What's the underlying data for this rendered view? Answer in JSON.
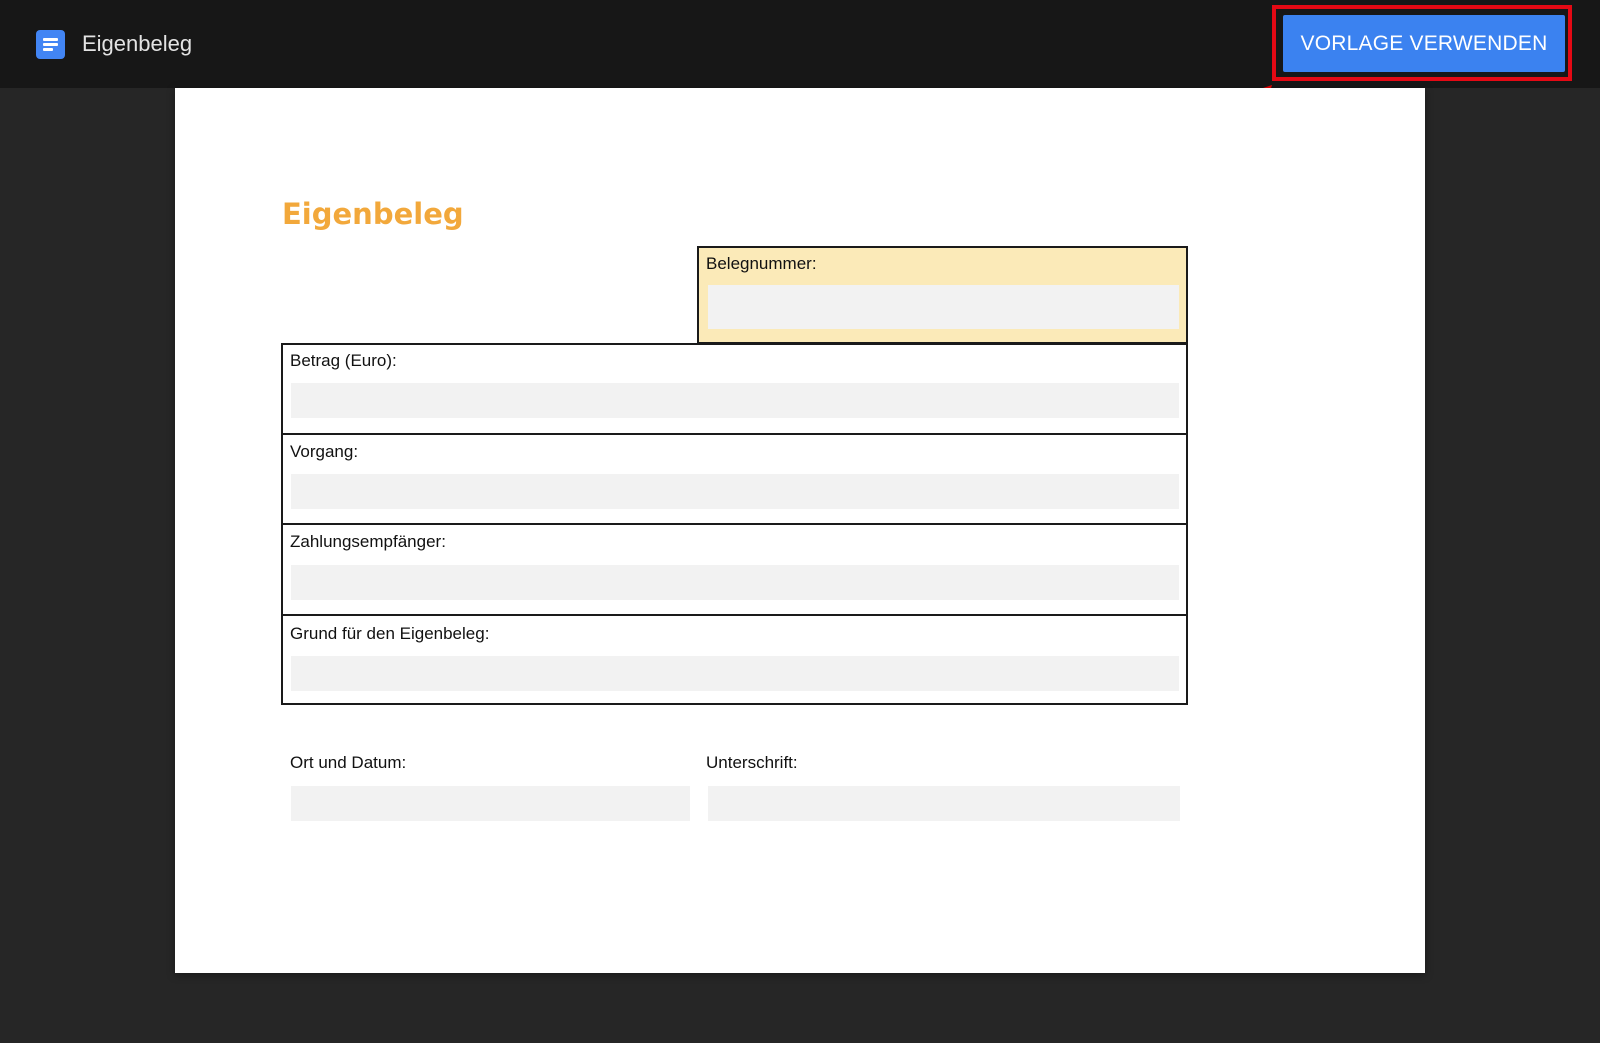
{
  "app": {
    "title": "Eigenbeleg",
    "icon": "docs-icon",
    "icon_color": "#4285f4"
  },
  "toolbar": {
    "use_template_label": "VORLAGE VERWENDEN",
    "button_color": "#3b82f0",
    "highlight_color": "#e50914"
  },
  "document": {
    "title": "Eigenbeleg",
    "title_color": "#f2a83b",
    "belegnummer": {
      "label": "Belegnummer:",
      "value": ""
    },
    "fields": [
      {
        "label": "Betrag (Euro):",
        "value": ""
      },
      {
        "label": "Vorgang:",
        "value": ""
      },
      {
        "label": "Zahlungsempfänger:",
        "value": ""
      },
      {
        "label": "Grund für den Eigenbeleg:",
        "value": ""
      }
    ],
    "ort_datum": {
      "label": "Ort und Datum:",
      "value": ""
    },
    "unterschrift": {
      "label": "Unterschrift:",
      "value": ""
    }
  }
}
